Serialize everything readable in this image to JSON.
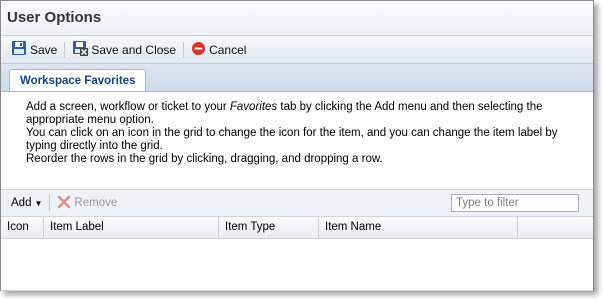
{
  "window": {
    "title": "User Options"
  },
  "toolbar": {
    "save_label": "Save",
    "save_close_label": "Save and Close",
    "cancel_label": "Cancel"
  },
  "tabs": [
    {
      "label": "Workspace Favorites",
      "active": true
    }
  ],
  "instructions": {
    "line1_pre": "Add a screen, workflow or ticket to your ",
    "line1_em": "Favorites",
    "line1_post": " tab by clicking the Add menu and then selecting the appropriate menu option.",
    "line2": "You can click on an icon in the grid to change the icon for the item, and you can change the item label by typing directly into the grid.",
    "line3": "Reorder the rows in the grid by clicking, dragging, and dropping a row."
  },
  "grid_toolbar": {
    "add_label": "Add",
    "remove_label": "Remove",
    "filter_placeholder": "Type to filter"
  },
  "grid": {
    "columns": [
      "Icon",
      "Item Label",
      "Item Type",
      "Item Name"
    ],
    "rows": []
  },
  "colors": {
    "tab_text": "#15428b",
    "cancel_red": "#d9352a",
    "save_blue": "#2f5fa8"
  }
}
